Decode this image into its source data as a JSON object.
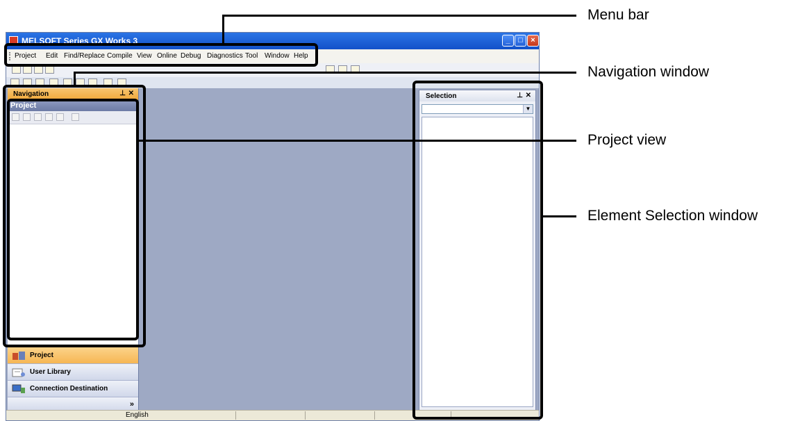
{
  "window": {
    "title": "MELSOFT Series GX Works 3"
  },
  "menubar": {
    "items": [
      "Project",
      "Edit",
      "Find/Replace",
      "Compile",
      "View",
      "Online",
      "Debug",
      "Diagnostics",
      "Tool",
      "Window",
      "Help"
    ]
  },
  "navigation": {
    "title": "Navigation",
    "project_view_title": "Project",
    "buttons": {
      "project": "Project",
      "user_library": "User Library",
      "connection_destination": "Connection Destination"
    },
    "more": "»"
  },
  "selection": {
    "title": "Selection"
  },
  "statusbar": {
    "language": "English"
  },
  "callouts": {
    "menu_bar": "Menu bar",
    "navigation_window": "Navigation window",
    "project_view": "Project view",
    "element_selection_window": "Element Selection window"
  },
  "colors": {
    "accent_title": "#1c5fd6",
    "nav_header": "#f0a83a",
    "workspace": "#9ea9c4"
  }
}
